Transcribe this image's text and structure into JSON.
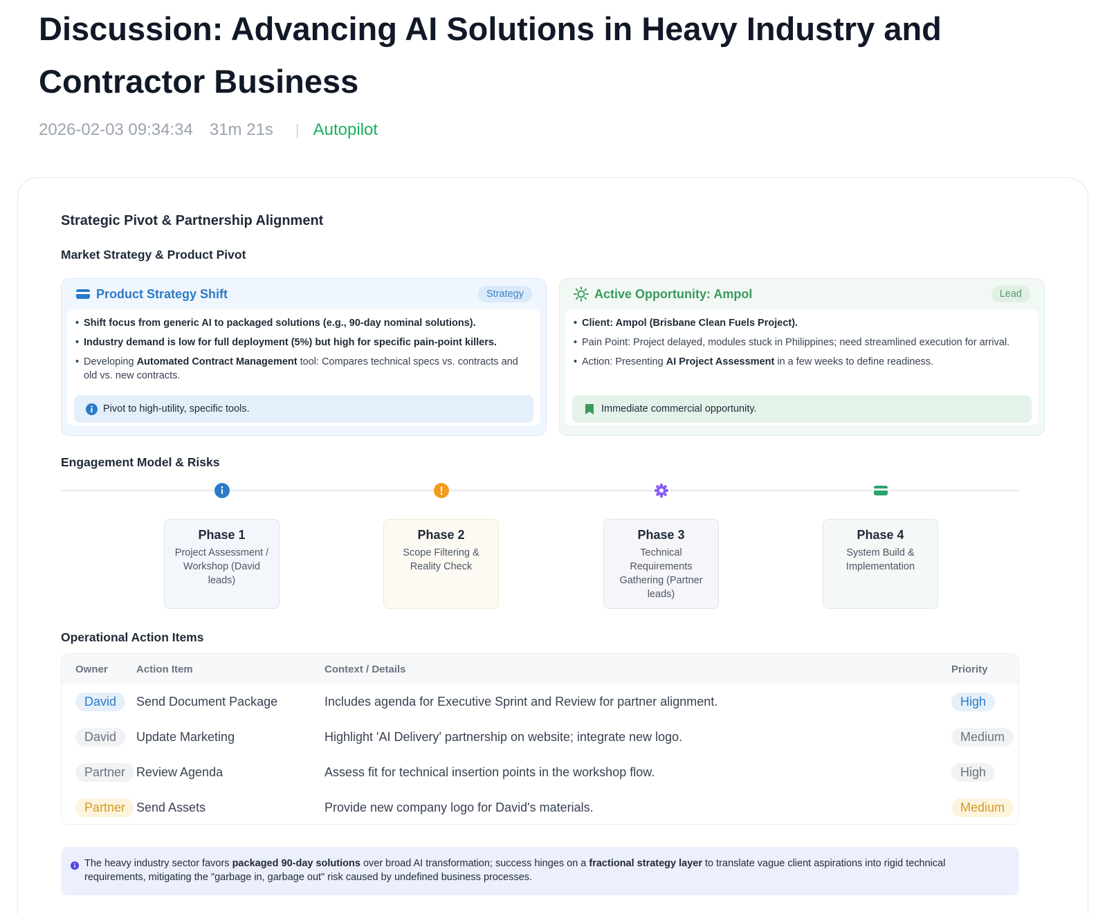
{
  "header": {
    "title": "Discussion: Advancing AI Solutions in Heavy Industry and Contractor Business",
    "timestamp": "2026-02-03 09:34:34",
    "duration": "31m 21s",
    "separator": "|",
    "mode": "Autopilot"
  },
  "report": {
    "section_title": "Strategic Pivot & Partnership Alignment",
    "market": {
      "heading": "Market Strategy & Product Pivot",
      "cards": [
        {
          "title": "Product Strategy Shift",
          "badge": "Strategy",
          "icon": "wallet-icon",
          "color": "#2b7bc9",
          "bullets": {
            "b1": "Shift focus from generic AI to packaged solutions (e.g., 90-day nominal solutions).",
            "b2": "Industry demand is low for full deployment (5%) but high for specific pain-point killers.",
            "b3_pre": "Developing ",
            "b3_bold": "Automated Contract Management",
            "b3_post": " tool: Compares technical specs vs. contracts and old vs. new contracts."
          },
          "callout": "Pivot to high-utility, specific tools.",
          "callout_icon": "info-icon"
        },
        {
          "title": "Active Opportunity: Ampol",
          "badge": "Lead",
          "icon": "sun-icon",
          "color": "#3a9a5d",
          "bullets": {
            "b1": "Client: Ampol (Brisbane Clean Fuels Project).",
            "b2": "Pain Point: Project delayed, modules stuck in Philippines; need streamlined execution for arrival.",
            "b3_pre": "Action: Presenting ",
            "b3_bold": "AI Project Assessment",
            "b3_post": " in a few weeks to define readiness."
          },
          "callout": "Immediate commercial opportunity.",
          "callout_icon": "bookmark-icon"
        }
      ]
    },
    "engagement": {
      "heading": "Engagement Model & Risks",
      "phases": [
        {
          "title": "Phase 1",
          "desc": "Project Assessment / Workshop (David leads)",
          "icon": "info-icon",
          "color": "#2b7bc9"
        },
        {
          "title": "Phase 2",
          "desc": "Scope Filtering & Reality Check",
          "icon": "warning-icon",
          "color": "#f29b1d"
        },
        {
          "title": "Phase 3",
          "desc": "Technical Requirements Gathering (Partner leads)",
          "icon": "gear-icon",
          "color": "#8b5cf6"
        },
        {
          "title": "Phase 4",
          "desc": "System Build & Implementation",
          "icon": "wallet-icon",
          "color": "#2aa36b"
        }
      ]
    },
    "actions": {
      "heading": "Operational Action Items",
      "columns": [
        "Owner",
        "Action Item",
        "Context / Details",
        "Priority"
      ],
      "rows": [
        {
          "owner": "David",
          "action": "Send Document Package",
          "context": "Includes agenda for Executive Sprint and Review for partner alignment.",
          "priority": "High"
        },
        {
          "owner": "David",
          "action": "Update Marketing",
          "context": "Highlight 'AI Delivery' partnership on website; integrate new logo.",
          "priority": "Medium"
        },
        {
          "owner": "Partner",
          "action": "Review Agenda",
          "context": "Assess fit for technical insertion points in the workshop flow.",
          "priority": "High"
        },
        {
          "owner": "Partner",
          "action": "Send Assets",
          "context": "Provide new company logo for David's materials.",
          "priority": "Medium"
        }
      ]
    },
    "summary": {
      "t1": "The heavy industry sector favors ",
      "b1": "packaged 90-day solutions",
      "t2": " over broad AI transformation; success hinges on a ",
      "b2": "fractional strategy layer",
      "t3": " to translate vague client aspirations into rigid technical requirements, mitigating the \"garbage in, garbage out\" risk caused by undefined business processes."
    }
  }
}
